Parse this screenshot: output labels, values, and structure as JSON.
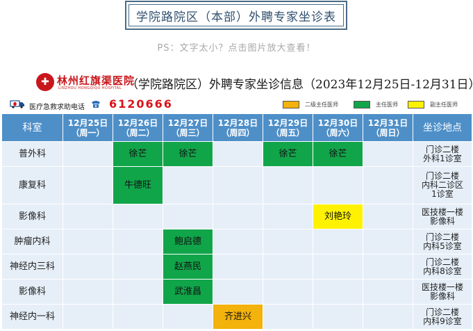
{
  "page": {
    "title": "学院路院区（本部）外聘专家坐诊表",
    "ps_note": "PS：文字太小？点击图片放大查看！"
  },
  "header": {
    "hospital_name": "林州红旗渠医院",
    "hospital_name_en": "LINZHOU HONGQIQU HOSPITAL",
    "main_title": "（学院路院区）外聘专家坐诊信息（2023年12月25日-12月31日）",
    "emergency_label": "医疗急救求助电话",
    "phone": "6120666"
  },
  "legend": [
    {
      "label": "二级主任医师",
      "color": "#f3b20c"
    },
    {
      "label": "主任医师",
      "color": "#11a54a"
    },
    {
      "label": "副主任医师",
      "color": "#fff200"
    }
  ],
  "colors": {
    "header_blue": "#4e8fc8",
    "cell_light": "#e6eff8",
    "phone_red": "#d8141b",
    "hospital_red": "#c8171c"
  },
  "table": {
    "dept_header": "科室",
    "loc_header": "坐诊地点",
    "days": [
      {
        "date": "12月25日",
        "weekday": "（周一）"
      },
      {
        "date": "12月26日",
        "weekday": "（周二）"
      },
      {
        "date": "12月27日",
        "weekday": "（周三）"
      },
      {
        "date": "12月28日",
        "weekday": "（周四）"
      },
      {
        "date": "12月29日",
        "weekday": "（周五）"
      },
      {
        "date": "12月30日",
        "weekday": "（周六）"
      },
      {
        "date": "12月31日",
        "weekday": "（周日）"
      }
    ],
    "rows": [
      {
        "dept": "普外科",
        "cells": [
          {
            "name": "",
            "level": ""
          },
          {
            "name": "徐芒",
            "level": "green"
          },
          {
            "name": "徐芒",
            "level": "green"
          },
          {
            "name": "",
            "level": ""
          },
          {
            "name": "徐芒",
            "level": "green"
          },
          {
            "name": "徐芒",
            "level": "green"
          },
          {
            "name": "",
            "level": ""
          }
        ],
        "location": [
          "门诊二楼",
          "外科1诊室"
        ]
      },
      {
        "dept": "康复科",
        "cells": [
          {
            "name": "",
            "level": ""
          },
          {
            "name": "牛德旺",
            "level": "green"
          },
          {
            "name": "",
            "level": ""
          },
          {
            "name": "",
            "level": ""
          },
          {
            "name": "",
            "level": ""
          },
          {
            "name": "",
            "level": ""
          },
          {
            "name": "",
            "level": ""
          }
        ],
        "location": [
          "门诊二楼",
          "内科二诊区",
          "1诊室"
        ]
      },
      {
        "dept": "影像科",
        "cells": [
          {
            "name": "",
            "level": ""
          },
          {
            "name": "",
            "level": ""
          },
          {
            "name": "",
            "level": ""
          },
          {
            "name": "",
            "level": ""
          },
          {
            "name": "",
            "level": ""
          },
          {
            "name": "刘艳玲",
            "level": "yellow"
          },
          {
            "name": "",
            "level": ""
          }
        ],
        "location": [
          "医技楼一楼",
          "影像科"
        ]
      },
      {
        "dept": "肿瘤内科",
        "cells": [
          {
            "name": "",
            "level": ""
          },
          {
            "name": "",
            "level": ""
          },
          {
            "name": "鲍启德",
            "level": "green"
          },
          {
            "name": "",
            "level": ""
          },
          {
            "name": "",
            "level": ""
          },
          {
            "name": "",
            "level": ""
          },
          {
            "name": "",
            "level": ""
          }
        ],
        "location": [
          "门诊二楼",
          "内科5诊室"
        ]
      },
      {
        "dept": "神经内三科",
        "cells": [
          {
            "name": "",
            "level": ""
          },
          {
            "name": "",
            "level": ""
          },
          {
            "name": "赵燕民",
            "level": "green"
          },
          {
            "name": "",
            "level": ""
          },
          {
            "name": "",
            "level": ""
          },
          {
            "name": "",
            "level": ""
          },
          {
            "name": "",
            "level": ""
          }
        ],
        "location": [
          "门诊二楼",
          "内科8诊室"
        ]
      },
      {
        "dept": "影像科",
        "cells": [
          {
            "name": "",
            "level": ""
          },
          {
            "name": "",
            "level": ""
          },
          {
            "name": "武淮昌",
            "level": "green"
          },
          {
            "name": "",
            "level": ""
          },
          {
            "name": "",
            "level": ""
          },
          {
            "name": "",
            "level": ""
          },
          {
            "name": "",
            "level": ""
          }
        ],
        "location": [
          "医技楼一楼",
          "影像科"
        ]
      },
      {
        "dept": "神经内一科",
        "cells": [
          {
            "name": "",
            "level": ""
          },
          {
            "name": "",
            "level": ""
          },
          {
            "name": "",
            "level": ""
          },
          {
            "name": "齐进兴",
            "level": "orange"
          },
          {
            "name": "",
            "level": ""
          },
          {
            "name": "",
            "level": ""
          },
          {
            "name": "",
            "level": ""
          }
        ],
        "location": [
          "门诊二楼",
          "内科9诊室"
        ]
      }
    ]
  }
}
